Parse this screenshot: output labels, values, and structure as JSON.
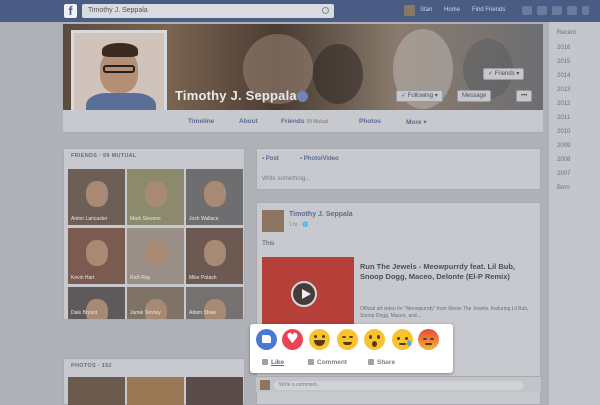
{
  "header": {
    "logo": "f",
    "search_value": "Timothy J. Seppala",
    "user_name": "Stan",
    "nav_home": "Home",
    "nav_find_friends": "Find Friends"
  },
  "timeline_years": [
    "Recent",
    "2016",
    "2015",
    "2014",
    "2013",
    "2012",
    "2011",
    "2010",
    "2009",
    "2008",
    "2007",
    "Born"
  ],
  "profile": {
    "name": "Timothy J. Seppala",
    "friends_button": "✓ Friends ▾",
    "following_button": "✓ Following ▾",
    "message_button": "Message",
    "more_button": "•••"
  },
  "tabs": [
    {
      "label": "Timeline",
      "count": ""
    },
    {
      "label": "About",
      "count": ""
    },
    {
      "label": "Friends",
      "count": "99 Mutual"
    },
    {
      "label": "Photos",
      "count": ""
    },
    {
      "label": "More ▾",
      "count": ""
    }
  ],
  "friends_card": {
    "title": "FRIENDS · 99 Mutual",
    "items": [
      {
        "label": "Anton Lancaster"
      },
      {
        "label": "Mark Stevens"
      },
      {
        "label": "Josh Wallace"
      },
      {
        "label": "Kevin Hart"
      },
      {
        "label": "Rich Ray"
      },
      {
        "label": "Mike Potash"
      },
      {
        "label": "Dale Bryant"
      },
      {
        "label": "Jamie Tenney"
      },
      {
        "label": "Adam Shaw"
      }
    ]
  },
  "photos_card": {
    "title": "PHOTOS · 152"
  },
  "composer": {
    "post_tab": "Post",
    "photo_tab": "Photo/Video",
    "placeholder": "Write something..."
  },
  "post": {
    "author": "Timothy J. Seppala",
    "time": "1 hr · 🌐",
    "text": "This",
    "link_title": "Run The Jewels - Meowpurrdy feat. Lil Bub, Snoop Dogg, Maceo, Delonte (El-P Remix)",
    "link_desc": "Official art video for \"Meowpurrdy\" from Meow The Jewels, featuring Lil Bub, Snoop Dogg, Maceo, and..."
  },
  "reactions": {
    "emojis": [
      "like-icon",
      "love-icon",
      "haha-icon",
      "yay-icon",
      "wow-icon",
      "sad-icon",
      "angry-icon"
    ],
    "like_label": "Like",
    "comment_label": "Comment",
    "share_label": "Share"
  },
  "comment": {
    "placeholder": "Write a comment..."
  },
  "colors": {
    "facebook_blue": "#4a5c84",
    "like_blue": "#4a78d6",
    "love_red": "#ef4055",
    "emoji_yellow": "#f8c32f"
  }
}
